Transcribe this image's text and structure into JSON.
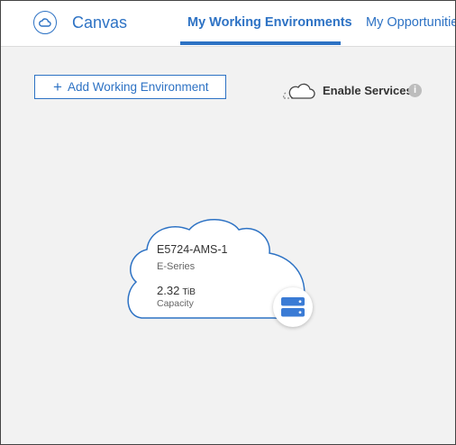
{
  "header": {
    "app_title": "Canvas",
    "app_icon": "cloud-icon",
    "tabs": [
      {
        "label": "My Working Environments",
        "active": true
      },
      {
        "label": "My Opportunities",
        "active": false
      }
    ]
  },
  "toolbar": {
    "add_label": "Add Working Environment",
    "add_icon": "plus-icon",
    "enable_services_label": "Enable Services",
    "info_icon": "info-icon"
  },
  "environment": {
    "name": "E5724-AMS-1",
    "type": "E-Series",
    "capacity_value": "2.32",
    "capacity_unit": "TiB",
    "capacity_label": "Capacity",
    "badge_icon": "storage-server-icon"
  },
  "colors": {
    "accent": "#2d72c4",
    "canvas_bg": "#f2f2f2",
    "badge_server": "#3a7bd5"
  }
}
